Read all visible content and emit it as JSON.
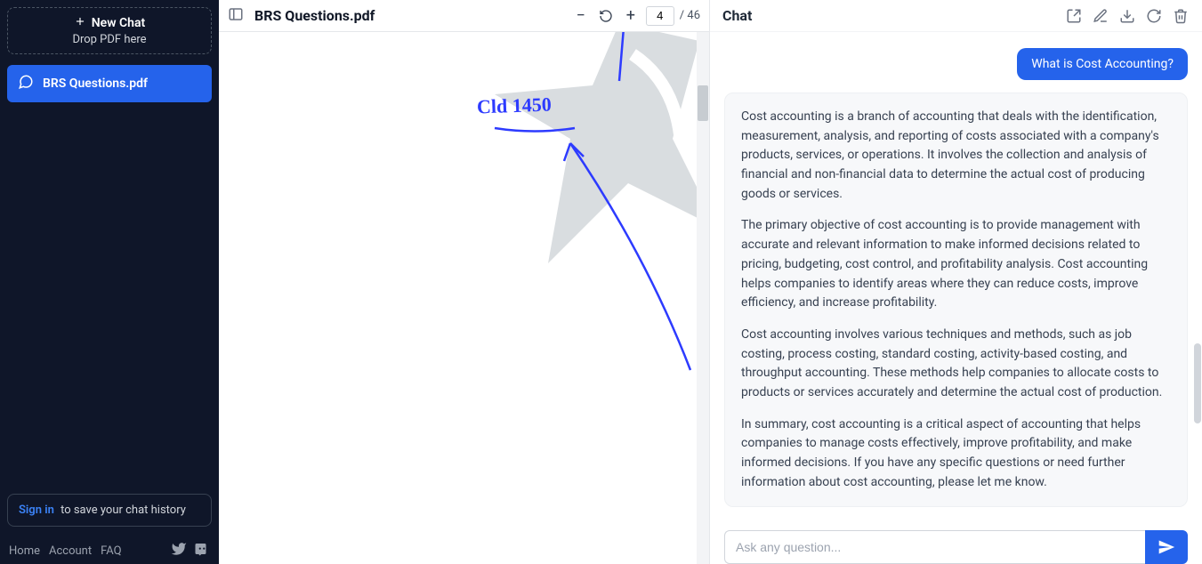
{
  "sidebar": {
    "new_chat_label": "New Chat",
    "drop_hint": "Drop PDF here",
    "active_chat_name": "BRS Questions.pdf",
    "signin_label": "Sign in",
    "signin_rest": "to save your chat history",
    "footer_links": {
      "home": "Home",
      "account": "Account",
      "faq": "FAQ"
    }
  },
  "pdf": {
    "title": "BRS Questions.pdf",
    "current_page": "4",
    "total_pages_label": "/ 46",
    "handwriting": "Cld 1450"
  },
  "chat": {
    "title": "Chat",
    "input_placeholder": "Ask any question...",
    "user_message": "What is Cost Accounting?",
    "ai_paragraphs": {
      "p1": "Cost accounting is a branch of accounting that deals with the identification, measurement, analysis, and reporting of costs associated with a company's products, services, or operations. It involves the collection and analysis of financial and non-financial data to determine the actual cost of producing goods or services.",
      "p2": "The primary objective of cost accounting is to provide management with accurate and relevant information to make informed decisions related to pricing, budgeting, cost control, and profitability analysis. Cost accounting helps companies to identify areas where they can reduce costs, improve efficiency, and increase profitability.",
      "p3": "Cost accounting involves various techniques and methods, such as job costing, process costing, standard costing, activity-based costing, and throughput accounting. These methods help companies to allocate costs to products or services accurately and determine the actual cost of production.",
      "p4": "In summary, cost accounting is a critical aspect of accounting that helps companies to manage costs effectively, improve profitability, and make informed decisions. If you have any specific questions or need further information about cost accounting, please let me know."
    }
  }
}
